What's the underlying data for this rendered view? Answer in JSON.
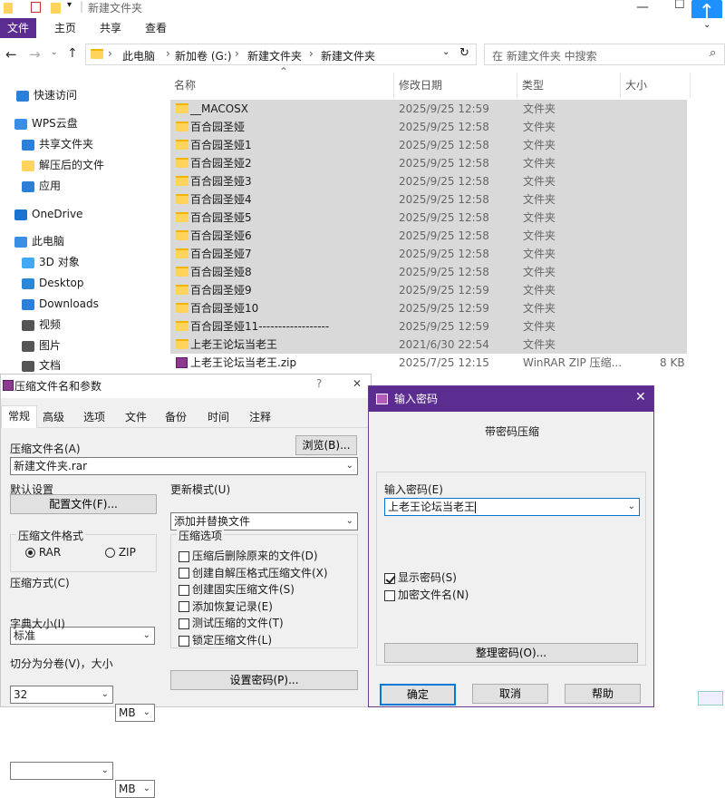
{
  "explorer": {
    "title": "新建文件夹",
    "ribbon_tabs": [
      "文件",
      "主页",
      "共享",
      "查看"
    ],
    "path": [
      "此电脑",
      "新加卷 (G:)",
      "新建文件夹",
      "新建文件夹"
    ],
    "search_placeholder": "在 新建文件夹 中搜索",
    "columns": [
      "名称",
      "修改日期",
      "类型",
      "大小"
    ],
    "nav": [
      {
        "label": "快速访问",
        "icon": "star-icon"
      },
      {
        "label": "WPS云盘",
        "icon": "cloud-icon"
      },
      {
        "label": "共享文件夹",
        "icon": "share-folder-icon"
      },
      {
        "label": "解压后的文件",
        "icon": "folder-icon"
      },
      {
        "label": "应用",
        "icon": "apps-icon"
      },
      {
        "label": "OneDrive",
        "icon": "onedrive-icon"
      },
      {
        "label": "此电脑",
        "icon": "pc-icon"
      },
      {
        "label": "3D 对象",
        "icon": "cube-icon"
      },
      {
        "label": "Desktop",
        "icon": "desktop-icon"
      },
      {
        "label": "Downloads",
        "icon": "download-icon"
      },
      {
        "label": "视频",
        "icon": "video-icon"
      },
      {
        "label": "图片",
        "icon": "image-icon"
      },
      {
        "label": "文档",
        "icon": "document-icon"
      }
    ],
    "files": [
      {
        "name": "__MACOSX",
        "date": "2025/9/25 12:59",
        "type": "文件夹",
        "size": "",
        "icon": "folder"
      },
      {
        "name": "百合园圣娅",
        "date": "2025/9/25 12:58",
        "type": "文件夹",
        "size": "",
        "icon": "folder"
      },
      {
        "name": "百合园圣娅1",
        "date": "2025/9/25 12:58",
        "type": "文件夹",
        "size": "",
        "icon": "folder"
      },
      {
        "name": "百合园圣娅2",
        "date": "2025/9/25 12:58",
        "type": "文件夹",
        "size": "",
        "icon": "folder"
      },
      {
        "name": "百合园圣娅3",
        "date": "2025/9/25 12:58",
        "type": "文件夹",
        "size": "",
        "icon": "folder"
      },
      {
        "name": "百合园圣娅4",
        "date": "2025/9/25 12:58",
        "type": "文件夹",
        "size": "",
        "icon": "folder"
      },
      {
        "name": "百合园圣娅5",
        "date": "2025/9/25 12:58",
        "type": "文件夹",
        "size": "",
        "icon": "folder"
      },
      {
        "name": "百合园圣娅6",
        "date": "2025/9/25 12:58",
        "type": "文件夹",
        "size": "",
        "icon": "folder"
      },
      {
        "name": "百合园圣娅7",
        "date": "2025/9/25 12:58",
        "type": "文件夹",
        "size": "",
        "icon": "folder"
      },
      {
        "name": "百合园圣娅8",
        "date": "2025/9/25 12:58",
        "type": "文件夹",
        "size": "",
        "icon": "folder"
      },
      {
        "name": "百合园圣娅9",
        "date": "2025/9/25 12:59",
        "type": "文件夹",
        "size": "",
        "icon": "folder"
      },
      {
        "name": "百合园圣娅10",
        "date": "2025/9/25 12:59",
        "type": "文件夹",
        "size": "",
        "icon": "folder"
      },
      {
        "name": "百合园圣娅11------------------",
        "date": "2025/9/25 12:59",
        "type": "文件夹",
        "size": "",
        "icon": "folder"
      },
      {
        "name": "上老王论坛当老王",
        "date": "2021/6/30 22:54",
        "type": "文件夹",
        "size": "",
        "icon": "folder"
      },
      {
        "name": "上老王论坛当老王.zip",
        "date": "2025/7/25 12:15",
        "type": "WinRAR ZIP 压缩...",
        "size": "8 KB",
        "icon": "zip"
      }
    ]
  },
  "rar": {
    "title": "压缩文件名和参数",
    "help": "?",
    "close": "✕",
    "tabs": [
      "常规",
      "高级",
      "选项",
      "文件",
      "备份",
      "时间",
      "注释"
    ],
    "archive_name_label": "压缩文件名(A)",
    "browse": "浏览(B)...",
    "archive_name": "新建文件夹.rar",
    "default_settings": "默认设置",
    "profiles": "配置文件(F)...",
    "update_mode_label": "更新模式(U)",
    "update_mode": "添加并替换文件",
    "format_label": "压缩文件格式",
    "format_rar": "RAR",
    "format_zip": "ZIP",
    "options_label": "压缩选项",
    "options": [
      {
        "label": "压缩后删除原来的文件(D)",
        "checked": false
      },
      {
        "label": "创建自解压格式压缩文件(X)",
        "checked": false
      },
      {
        "label": "创建固实压缩文件(S)",
        "checked": false
      },
      {
        "label": "添加恢复记录(E)",
        "checked": false
      },
      {
        "label": "测试压缩的文件(T)",
        "checked": false
      },
      {
        "label": "锁定压缩文件(L)",
        "checked": false
      }
    ],
    "method_label": "压缩方式(C)",
    "method": "标准",
    "dict_label": "字典大小(I)",
    "dict": "32",
    "dict_unit": "MB",
    "split_label": "切分为分卷(V)，大小",
    "split": "",
    "split_unit": "MB",
    "set_password": "设置密码(P)..."
  },
  "pw": {
    "title": "输入密码",
    "close": "✕",
    "subtitle": "带密码压缩",
    "enter_label": "输入密码(E)",
    "password": "上老王论坛当老王",
    "show_pw": "显示密码(S)",
    "show_pw_checked": true,
    "encrypt_names": "加密文件名(N)",
    "encrypt_names_checked": false,
    "organize": "整理密码(O)...",
    "ok": "确定",
    "cancel": "取消",
    "help": "帮助"
  },
  "colors": {
    "accent": "#5c2d91",
    "selection": "#d9d9d9",
    "folder": "#ffd35c"
  }
}
